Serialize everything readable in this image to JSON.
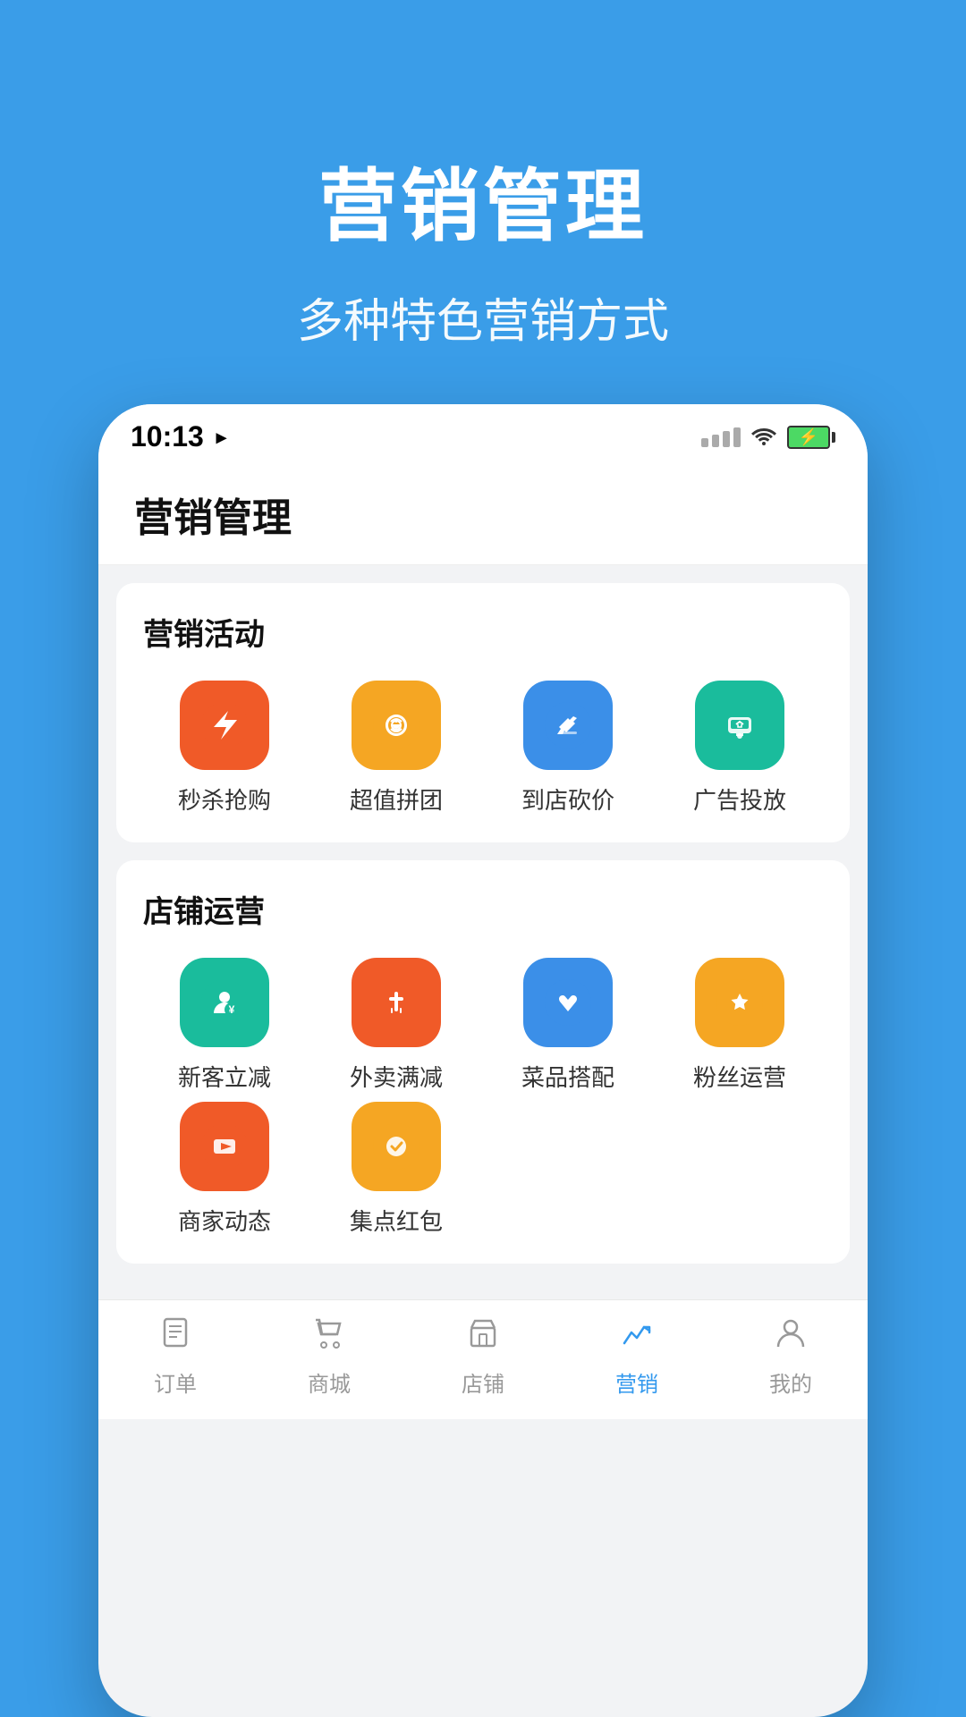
{
  "page": {
    "background_color": "#3399ee",
    "main_title": "营销管理",
    "sub_title": "多种特色营销方式"
  },
  "status_bar": {
    "time": "10:13",
    "time_arrow": "▸"
  },
  "phone": {
    "page_title": "营销管理",
    "sections": [
      {
        "id": "marketing",
        "title": "营销活动",
        "items": [
          {
            "id": "flash-sale",
            "label": "秒杀抢购",
            "bg": "#f05a28",
            "icon": "⚡"
          },
          {
            "id": "group-buy",
            "label": "超值拼团",
            "bg": "#f5a623",
            "icon": "✿"
          },
          {
            "id": "in-store",
            "label": "到店砍价",
            "bg": "#3b8fe8",
            "icon": "✂"
          },
          {
            "id": "advertise",
            "label": "广告投放",
            "bg": "#1abc9c",
            "icon": "💬"
          }
        ]
      },
      {
        "id": "store",
        "title": "店铺运营",
        "items": [
          {
            "id": "new-discount",
            "label": "新客立减",
            "bg": "#1abc9c",
            "icon": "👤"
          },
          {
            "id": "delivery",
            "label": "外卖满减",
            "bg": "#f05a28",
            "icon": "🍴"
          },
          {
            "id": "combo",
            "label": "菜品搭配",
            "bg": "#3b8fe8",
            "icon": "👍"
          },
          {
            "id": "fans",
            "label": "粉丝运营",
            "bg": "#f5a623",
            "icon": "♥"
          },
          {
            "id": "merchant",
            "label": "商家动态",
            "bg": "#f05a28",
            "icon": "▶"
          },
          {
            "id": "redpack",
            "label": "集点红包",
            "bg": "#f5a623",
            "icon": "✓"
          }
        ]
      }
    ]
  },
  "bottom_nav": {
    "items": [
      {
        "id": "orders",
        "label": "订单",
        "icon": "≡",
        "active": false
      },
      {
        "id": "mall",
        "label": "商城",
        "icon": "🛍",
        "active": false
      },
      {
        "id": "store",
        "label": "店铺",
        "icon": "◫",
        "active": false
      },
      {
        "id": "marketing",
        "label": "营销",
        "icon": "📈",
        "active": true
      },
      {
        "id": "mine",
        "label": "我的",
        "icon": "👤",
        "active": false
      }
    ]
  }
}
